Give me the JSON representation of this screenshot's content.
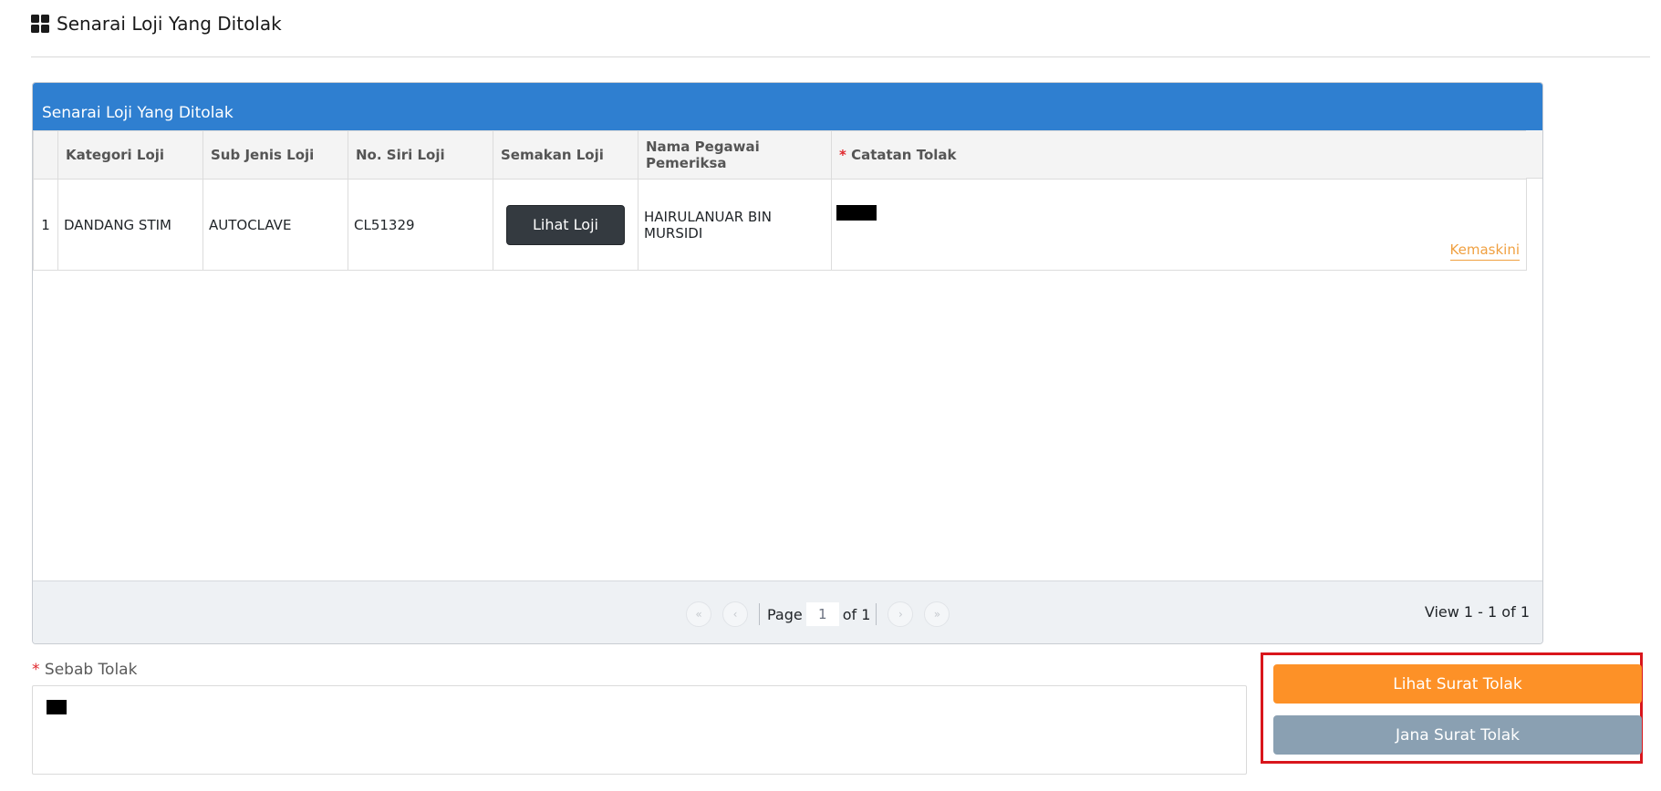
{
  "page": {
    "title": "Senarai Loji Yang Ditolak"
  },
  "panel": {
    "title": "Senarai Loji Yang Ditolak",
    "columns": [
      "Kategori Loji",
      "Sub Jenis Loji",
      "No. Siri Loji",
      "Semakan Loji",
      "Nama Pegawai Pemeriksa",
      "Catatan Tolak"
    ],
    "required_marker": "*",
    "rows": [
      {
        "no": "1",
        "kategori": "DANDANG STIM",
        "sub_jenis": "AUTOCLAVE",
        "no_siri": "CL51329",
        "semakan_button": "Lihat Loji",
        "pegawai": "HAIRULANUAR BIN MURSIDI",
        "catatan_action": "Kemaskini"
      }
    ]
  },
  "pager": {
    "first_icon": "«",
    "prev_icon": "‹",
    "next_icon": "›",
    "last_icon": "»",
    "page_label": "Page",
    "page_value": "1",
    "of_label": "of 1",
    "view_info": "View 1 - 1 of 1"
  },
  "form": {
    "required_marker": "*",
    "sebab_label": "Sebab Tolak"
  },
  "actions": {
    "lihat_surat": "Lihat Surat Tolak",
    "jana_surat": "Jana Surat Tolak"
  },
  "colors": {
    "header_blue": "#2f7fd0",
    "orange": "#fd9127",
    "gray_blue": "#8aa0b2",
    "highlight_red": "#d9161c",
    "dark_button": "#343a40"
  }
}
